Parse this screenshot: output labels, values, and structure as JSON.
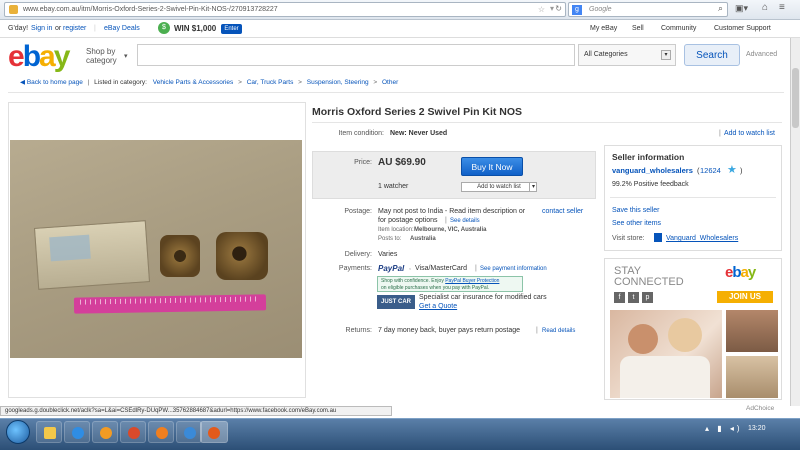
{
  "browser": {
    "url": "www.ebay.com.au/itm/Morris-Oxford-Series-2-Swivel-Pin-Kit-NOS-/270913728227",
    "search_engine": "Google",
    "search_placeholder": "Google"
  },
  "topbar": {
    "greeting": "G'day!",
    "sign_in": "Sign in",
    "or": "or",
    "register": "register",
    "deals": "eBay Deals",
    "promo": "WIN $1,000",
    "enter": "Enter",
    "my_ebay": "My eBay",
    "sell": "Sell",
    "community": "Community",
    "support": "Customer Support"
  },
  "header": {
    "shop_by": "Shop by",
    "category": "category",
    "category_select": "All Categories",
    "search_button": "Search",
    "advanced": "Advanced"
  },
  "breadcrumb": {
    "back": "Back to home page",
    "listed": "Listed in category:",
    "items": [
      "Vehicle Parts & Accessories",
      "Car, Truck Parts",
      "Suspension, Steering",
      "Other"
    ]
  },
  "item": {
    "title": "Morris Oxford Series 2 Swivel Pin Kit NOS",
    "condition_label": "Item condition:",
    "condition": "New: Never Used",
    "add_watch_top": "Add to watch list",
    "price_label": "Price:",
    "price": "AU $69.90",
    "buy_now": "Buy It Now",
    "watchers": "1 watcher",
    "add_watch_btn": "Add to watch list",
    "postage_label": "Postage:",
    "postage_text": "May not post to India - Read item description or",
    "contact_seller": "contact seller",
    "postage_text2": "for postage options",
    "see_details": "See details",
    "item_location_label": "Item location:",
    "item_location": "Melbourne, VIC, Australia",
    "posts_to_label": "Posts to:",
    "posts_to": "Australia",
    "delivery_label": "Delivery:",
    "delivery": "Varies",
    "payments_label": "Payments:",
    "paypal": "PayPal",
    "visa": "Visa/MasterCard",
    "see_payment": "See payment information",
    "paypal_notice_1": "Shop with confidence. Enjoy",
    "paypal_protect": "PayPal Buyer Protection",
    "paypal_notice_2": "on eligible purchases when you pay with PayPal.",
    "justcar": "JUST CAR",
    "insurance": "Specialist car insurance for modified cars",
    "get_quote": "Get a Quote",
    "returns_label": "Returns:",
    "returns": "7 day money back, buyer pays return postage",
    "returns_details": "Read details"
  },
  "seller": {
    "heading": "Seller information",
    "name": "vanguard_wholesalers",
    "feedback_score": "12624",
    "positive": "99.2% Positive feedback",
    "save": "Save this seller",
    "other_items": "See other items",
    "visit_label": "Visit store:",
    "store": "Vanguard_Wholesalers"
  },
  "ad": {
    "stay": "STAY",
    "connected": "CONNECTED",
    "join": "JOIN US",
    "adchoice": "AdChoice"
  },
  "status_url": "googleads.g.doubleclick.net/aclk?sa=L&ai=CSEdlRy-DUqPW...35762884687&adurl=https://www.facebook.com/eBay.com.au",
  "clock": "13:20",
  "colors": {
    "link": "#0654ba",
    "buy_button": "#1060c8",
    "join_button": "#f5af02"
  }
}
